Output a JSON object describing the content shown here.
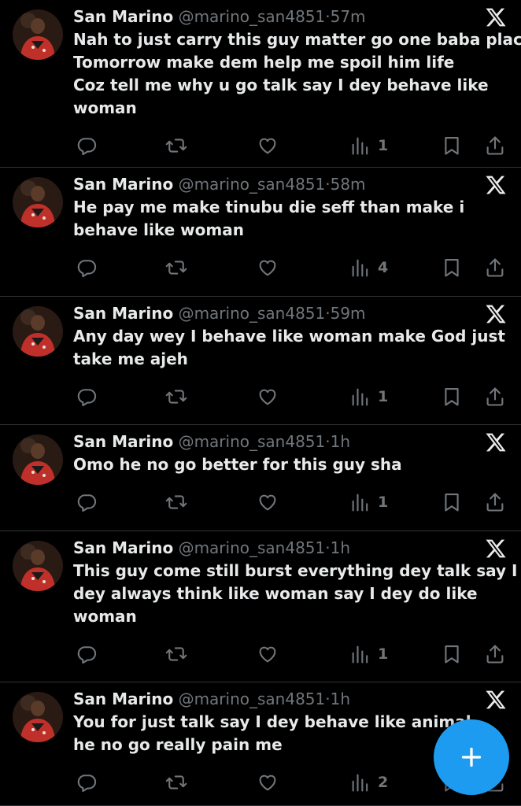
{
  "colors": {
    "background": "#000000",
    "text": "#e7e9ea",
    "muted": "#71767b",
    "divider": "#2f3336",
    "accent": "#1d9bf0"
  },
  "tweets": [
    {
      "name": "San Marino",
      "handle": "@marino_san4851",
      "sep": "·",
      "time": "57m",
      "lines": [
        "Nah to just carry this guy matter go one baba place",
        "Tomorrow make dem help me spoil him life",
        "Coz tell me why u go talk say I dey behave like",
        "woman"
      ],
      "views": "1"
    },
    {
      "name": "San Marino",
      "handle": "@marino_san4851",
      "sep": "·",
      "time": "58m",
      "lines": [
        "He pay me make tinubu die seff than make i",
        "behave like woman"
      ],
      "views": "4"
    },
    {
      "name": "San Marino",
      "handle": "@marino_san4851",
      "sep": "·",
      "time": "59m",
      "lines": [
        "Any day wey I behave like woman make God just",
        "take me ajeh"
      ],
      "views": "1"
    },
    {
      "name": "San Marino",
      "handle": "@marino_san4851",
      "sep": "·",
      "time": "1h",
      "lines": [
        "Omo he no go better for this guy sha"
      ],
      "views": "1"
    },
    {
      "name": "San Marino",
      "handle": "@marino_san4851",
      "sep": "·",
      "time": "1h",
      "lines": [
        "This guy come still burst everything dey talk say I",
        "dey always think like woman say I dey do like",
        "woman"
      ],
      "views": "1"
    },
    {
      "name": "San Marino",
      "handle": "@marino_san4851",
      "sep": "·",
      "time": "1h",
      "lines": [
        "You for just talk say I dey behave like animal",
        "he no go really pain me"
      ],
      "views": "2"
    }
  ],
  "icons": {
    "reply": "reply-icon",
    "retweet": "retweet-icon",
    "like": "heart-icon",
    "views": "views-icon",
    "bookmark": "bookmark-icon",
    "share": "share-icon",
    "platform": "x-logo-icon",
    "compose": "plus-icon"
  }
}
